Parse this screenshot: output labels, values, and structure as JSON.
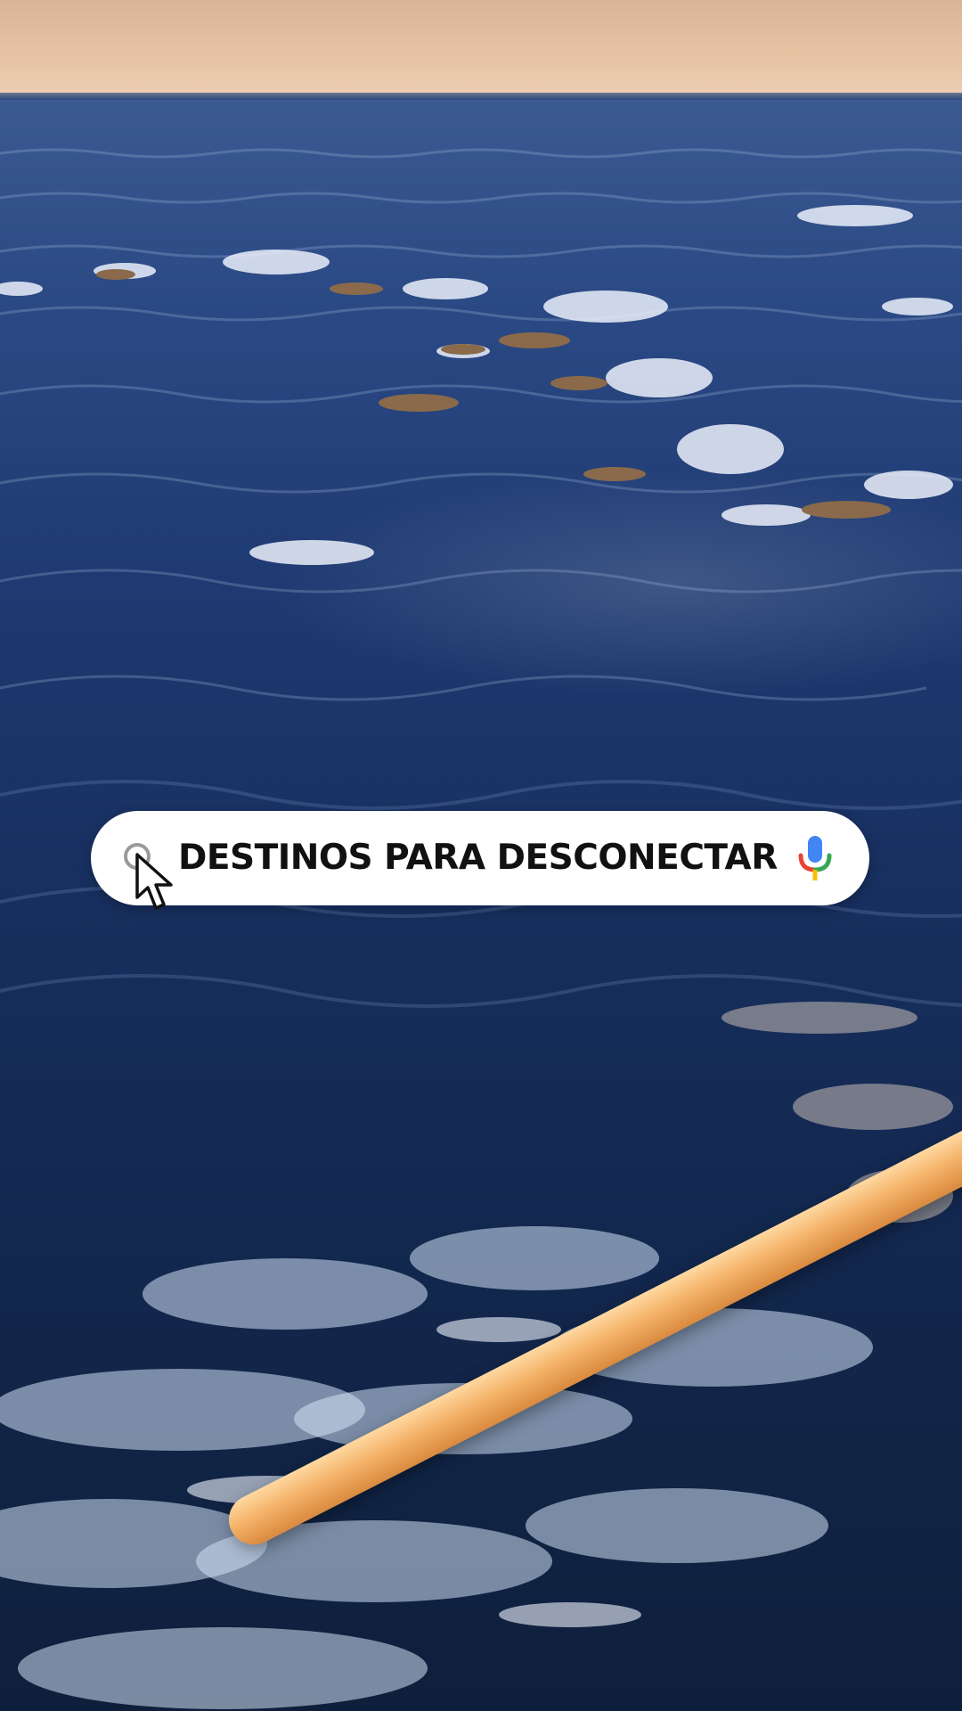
{
  "search": {
    "query": "DESTINOS PARA DESCONECTAR",
    "leading_icon": "search-icon",
    "trailing_icon": "mic-icon"
  },
  "cursor": {
    "icon": "cursor-arrow-icon"
  },
  "colors": {
    "search_bg": "#ffffff",
    "text": "#111111",
    "mic_blue": "#4285F4",
    "mic_red": "#EA4335",
    "mic_yellow": "#FBBC05",
    "mic_green": "#34A853",
    "rail": "#f4b36a"
  }
}
